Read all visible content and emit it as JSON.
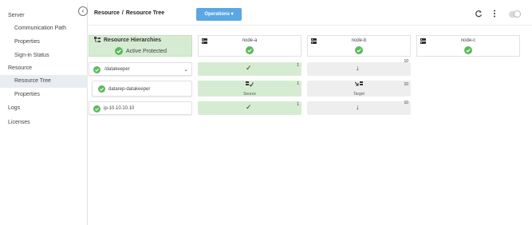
{
  "sidebar": {
    "collapse_glyph": "‹",
    "items": [
      {
        "label": "Server"
      },
      {
        "label": "Communication Path"
      },
      {
        "label": "Properties"
      },
      {
        "label": "Sign-in Status"
      },
      {
        "label": "Resource"
      },
      {
        "label": "Resource Tree"
      },
      {
        "label": "Properties"
      },
      {
        "label": "Logs"
      },
      {
        "label": "Licenses"
      }
    ]
  },
  "header": {
    "breadcrumb_root": "Resource",
    "breadcrumb_sep": "/",
    "breadcrumb_current": "Resource Tree",
    "operations_label": "Operations",
    "operations_caret": "▾"
  },
  "tree": {
    "header_title": "Resource Hierarchies",
    "header_status": "Active Protected",
    "rows": [
      {
        "label": "/datakeeper",
        "chevron": "⌄"
      },
      {
        "label": "datarep-datakeeper"
      },
      {
        "label": "ip-10.10.10.10"
      }
    ]
  },
  "nodes": [
    {
      "name": "node-a"
    },
    {
      "name": "node-b"
    },
    {
      "name": "node-c"
    }
  ],
  "cells": {
    "node_a": [
      {
        "priority": "1",
        "glyph": "✓",
        "role": ""
      },
      {
        "priority": "1",
        "glyph": "",
        "role": "Source"
      },
      {
        "priority": "1",
        "glyph": "✓",
        "role": ""
      }
    ],
    "node_b": [
      {
        "priority": "10",
        "glyph": "↓",
        "role": ""
      },
      {
        "priority": "10",
        "glyph": "",
        "role": "Target"
      },
      {
        "priority": "10",
        "glyph": "↓",
        "role": ""
      }
    ]
  },
  "colors": {
    "active_green": "#d6ecd2",
    "check_green": "#5cb85c",
    "operations_blue": "#5aa7e3",
    "standby_gray": "#eeeeee"
  },
  "icons": {
    "status": "check-circle-icon",
    "hierarchy": "hierarchy-icon",
    "server": "server-icon",
    "refresh": "refresh-icon",
    "more": "kebab-menu-icon",
    "source": "mirror-source-icon",
    "target": "mirror-target-icon"
  }
}
